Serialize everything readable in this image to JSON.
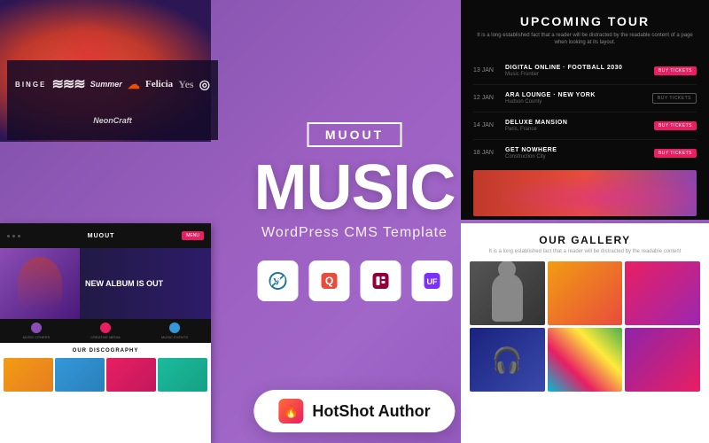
{
  "page": {
    "background": "purple-gradient"
  },
  "topLeft": {
    "description": "Artist with smoke photo"
  },
  "logos": {
    "items": [
      "BINGE",
      "≡|||||≡",
      "Summer",
      "☁",
      "Felicia",
      "Yes",
      "♬",
      "NeonCraft"
    ]
  },
  "tourPanel": {
    "title": "UPCOMING TOUR",
    "subtitle": "It is a long established fact that a reader will be distracted by the readable content of a page when looking at its layout.",
    "rows": [
      {
        "date": "13 JAN",
        "venue": "DIGITAL ONLINE - FOOTBALL 2030",
        "city": "Music Frontier",
        "btnText": "BUY TICKETS",
        "sold": false
      },
      {
        "date": "12 JAN",
        "venue": "ARA LOUNGE - NEW YORK",
        "city": "Hudson County",
        "btnText": "BUY TICKETS",
        "sold": true
      },
      {
        "date": "14 JAN",
        "venue": "DELUXE MANSION",
        "city": "Paris, France",
        "btnText": "BUY TICKETS",
        "sold": false
      },
      {
        "date": "18 JAN",
        "venue": "GET NOWHERE",
        "city": "Construction City",
        "btnText": "BUY TICKETS",
        "sold": false
      }
    ]
  },
  "center": {
    "badge": "MUOUT",
    "mainTitle": "MUSIC",
    "subtitle": "WordPress CMS Template",
    "techIcons": [
      {
        "name": "WordPress",
        "symbol": "W",
        "color": "#21759b"
      },
      {
        "name": "Quform",
        "symbol": "Q",
        "color": "#e53e3e"
      },
      {
        "name": "Elementor",
        "symbol": "E",
        "color": "#92003b"
      },
      {
        "name": "UF",
        "symbol": "⚡",
        "color": "#7b2fff"
      }
    ]
  },
  "websitePreview": {
    "logoText": "MUOUT",
    "heroTitle": "NEW ALBUM IS OUT",
    "features": [
      "MUSIC OTHERS",
      "CREATIVE MEDIA",
      "MUSIC EVENTS"
    ],
    "discographyTitle": "OUR DISCOGRAPHY"
  },
  "gallery": {
    "title": "OUR GALLERY",
    "subtitle": "It is a long established fact that a reader will be distracted by the readable content"
  },
  "authorBadge": {
    "iconEmoji": "🔥",
    "name": "HotShot Author"
  }
}
